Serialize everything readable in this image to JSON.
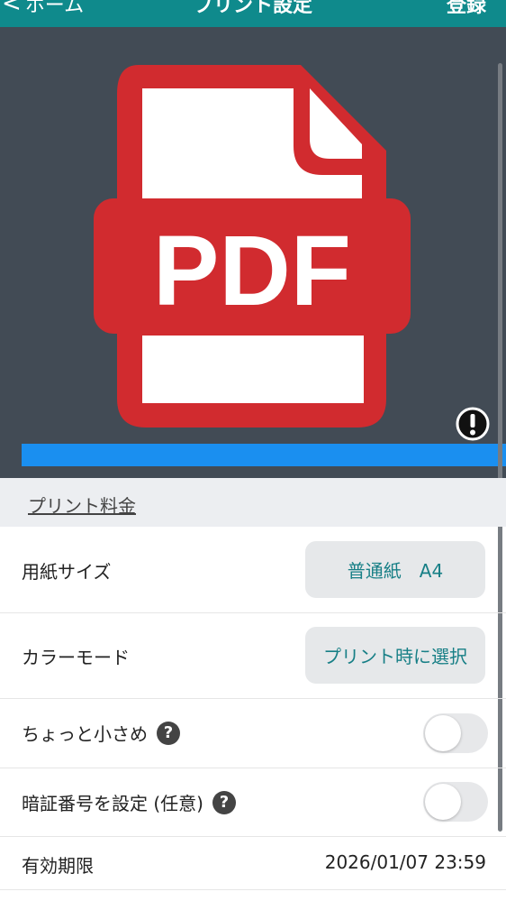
{
  "header": {
    "back_label": "ホーム",
    "title": "プリント設定",
    "register_label": "登録"
  },
  "preview": {
    "file_type_text": "PDF",
    "progress_fraction": 1.0,
    "accent_color": "#1a8ff0",
    "pdf_color": "#d12b2f"
  },
  "fee": {
    "label": "プリント料金"
  },
  "settings": {
    "paper_size": {
      "label": "用紙サイズ",
      "value": "普通紙　A4"
    },
    "color_mode": {
      "label": "カラーモード",
      "value": "プリント時に選択"
    },
    "slightly_smaller": {
      "label": "ちょっと小さめ",
      "enabled": false
    },
    "pin": {
      "label": "暗証番号を設定 (任意)",
      "enabled": false
    },
    "expiry": {
      "label": "有効期限",
      "value": "2026/01/07 23:59"
    }
  },
  "icons": {
    "help": "?",
    "warning": "!",
    "back": "<"
  }
}
